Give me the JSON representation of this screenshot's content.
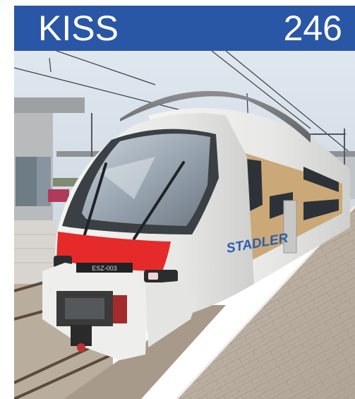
{
  "header": {
    "model": "KISS",
    "number": "246",
    "background_color": "#2a56a6",
    "text_color": "#ffffff"
  },
  "photo": {
    "subject": "train-photo",
    "logo_text": "STADLER",
    "plate_text": "ESZ-003",
    "stripe_color": "#e62a2a"
  }
}
